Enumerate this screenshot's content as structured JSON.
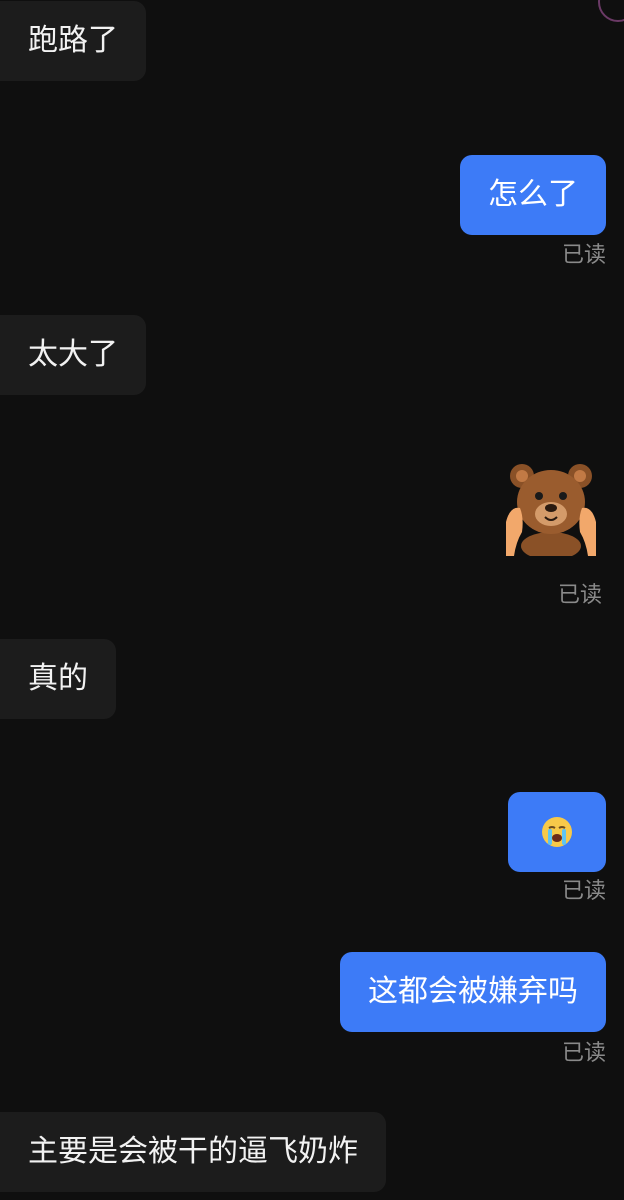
{
  "messages": [
    {
      "side": "in",
      "text": "跑路了"
    },
    {
      "side": "out",
      "text": "怎么了",
      "status": "已读"
    },
    {
      "side": "in",
      "text": "太大了"
    },
    {
      "side": "out",
      "type": "sticker",
      "sticker": "bear-covering-cheeks",
      "status": "已读"
    },
    {
      "side": "in",
      "text": "真的"
    },
    {
      "side": "out",
      "type": "emoji",
      "emoji": "loudly-crying-face",
      "status": "已读"
    },
    {
      "side": "out",
      "text": "这都会被嫌弃吗",
      "status": "已读"
    },
    {
      "side": "in",
      "text": "主要是会被干的逼飞奶炸"
    }
  ],
  "colors": {
    "background": "#0f0f0f",
    "incoming_bubble": "#1c1c1c",
    "outgoing_bubble": "#3d7bf7",
    "read_receipt": "#8a8a8a"
  }
}
